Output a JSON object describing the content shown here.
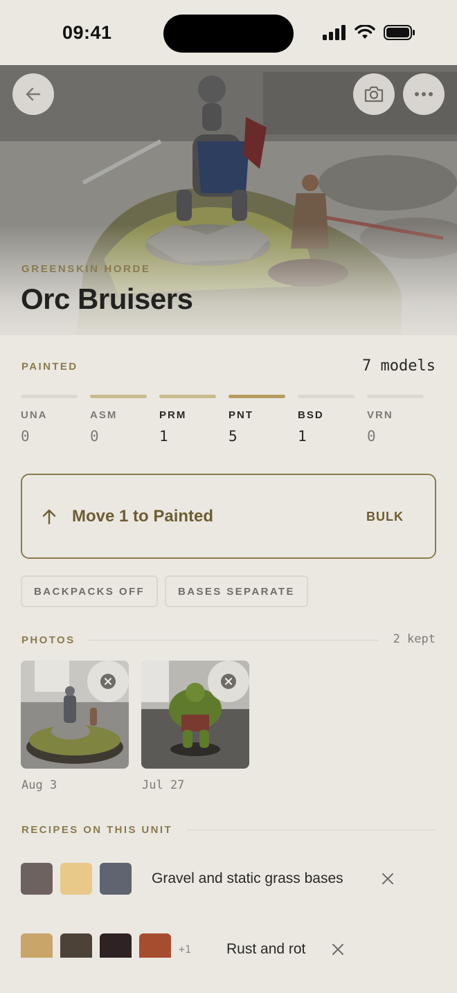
{
  "status_bar": {
    "time": "09:41"
  },
  "hero": {
    "faction": "GREENSKIN HORDE",
    "title": "Orc Bruisers",
    "back_icon": "arrow-left-icon",
    "camera_icon": "camera-icon",
    "more_icon": "more-horizontal-icon"
  },
  "status": {
    "label": "PAINTED",
    "count": "7 models",
    "stages": [
      {
        "code": "UNA",
        "count": "0"
      },
      {
        "code": "ASM",
        "count": "0"
      },
      {
        "code": "PRM",
        "count": "1"
      },
      {
        "code": "PNT",
        "count": "5"
      },
      {
        "code": "BSD",
        "count": "1"
      },
      {
        "code": "VRN",
        "count": "0"
      }
    ]
  },
  "action": {
    "label": "Move 1 to Painted",
    "bulk": "BULK"
  },
  "tags": [
    "BACKPACKS OFF",
    "BASES SEPARATE"
  ],
  "photos": {
    "label": "PHOTOS",
    "kept": "2 kept",
    "items": [
      {
        "date": "Aug 3"
      },
      {
        "date": "Jul 27"
      }
    ]
  },
  "recipes": {
    "label": "RECIPES ON THIS UNIT",
    "items": [
      {
        "name": "Gravel and static grass bases",
        "swatches": [
          "#6e6260",
          "#e9c98a",
          "#5f6470"
        ],
        "more": ""
      },
      {
        "name": "Rust and rot",
        "swatches": [
          "#c9a56a",
          "#4c4238",
          "#2e2224",
          "#a64d30"
        ],
        "more": "+1"
      }
    ]
  },
  "colors": {
    "accent": "#8a7a4e",
    "accent_dark": "#6d5d31",
    "background": "#ebe8e2"
  }
}
